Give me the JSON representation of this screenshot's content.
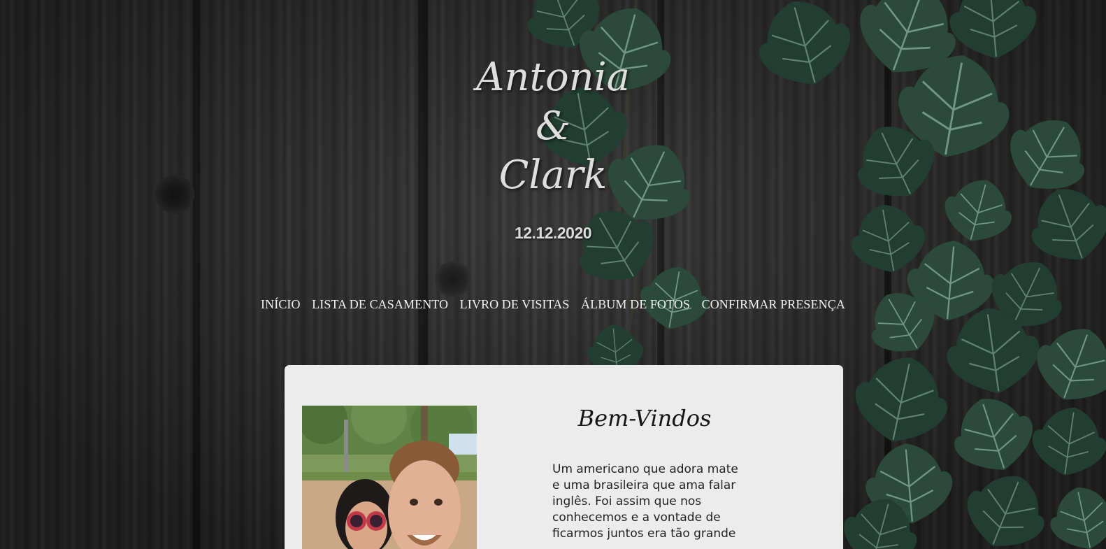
{
  "header": {
    "name_one": "Antonia",
    "ampersand": "&",
    "name_two": "Clark",
    "date": "12.12.2020"
  },
  "nav": {
    "items": [
      "INÍCIO",
      "LISTA DE CASAMENTO",
      "LIVRO DE VISITAS",
      "ÁLBUM DE FOTOS",
      "CONFIRMAR PRESENÇA"
    ]
  },
  "welcome": {
    "title": "Bem-Vindos",
    "text": "Um americano que adora mate e uma brasileira que ama falar inglês. Foi assim que nos conhecemos e a vontade de ficarmos juntos era tão grande"
  },
  "colors": {
    "background_wood": "#2c2c2c",
    "ivy_leaf": "#2c4a3c",
    "card": "#ececec",
    "header_text": "#dedede"
  },
  "icons": {
    "decoration": "ivy-leaves"
  }
}
